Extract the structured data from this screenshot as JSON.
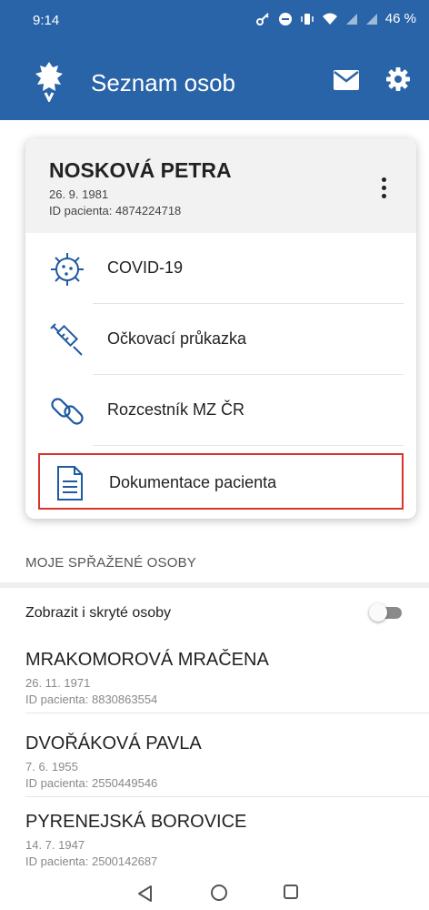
{
  "status_bar": {
    "time": "9:14",
    "battery": "46 %"
  },
  "app_bar": {
    "title": "Seznam osob"
  },
  "patient": {
    "name": "NOSKOVÁ PETRA",
    "dob": "26. 9. 1981",
    "patient_id": "ID pacienta: 4874224718"
  },
  "menu": [
    {
      "label": "COVID-19",
      "icon": "virus-icon"
    },
    {
      "label": "Očkovací průkazka",
      "icon": "syringe-icon"
    },
    {
      "label": "Rozcestník MZ ČR",
      "icon": "link-icon"
    },
    {
      "label": "Dokumentace pacienta",
      "icon": "document-icon"
    }
  ],
  "linked_section": {
    "title": "MOJE SPŘAŽENÉ OSOBY",
    "toggle_label": "Zobrazit i skryté osoby",
    "toggle_on": false
  },
  "persons": [
    {
      "name": "MRAKOMOROVÁ MRAČENA",
      "dob": "26. 11. 1971",
      "patient_id": "ID pacienta: 8830863554"
    },
    {
      "name": "DVOŘÁKOVÁ PAVLA",
      "dob": "7. 6. 1955",
      "patient_id": "ID pacienta: 2550449546"
    },
    {
      "name": "PYRENEJSKÁ BOROVICE",
      "dob": "14. 7. 1947",
      "patient_id": "ID pacienta: 2500142687"
    }
  ],
  "colors": {
    "primary": "#2a64a8",
    "highlight": "#d9342b",
    "icon": "#1e5aa0"
  }
}
